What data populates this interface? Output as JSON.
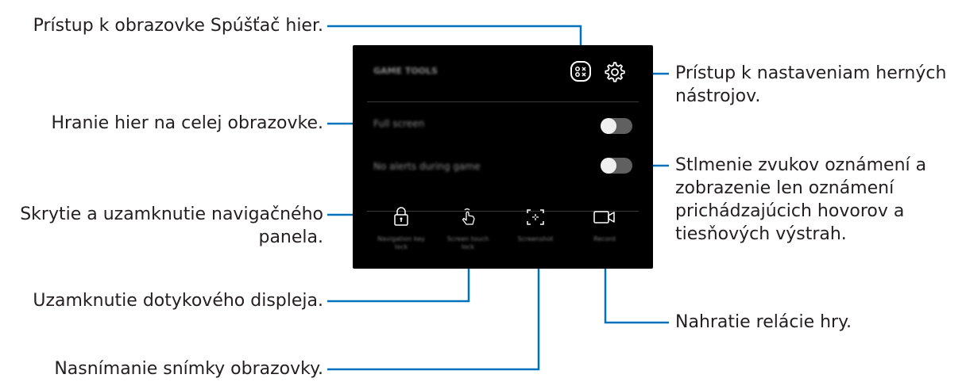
{
  "panel": {
    "title": "GAME TOOLS",
    "full_screen_label": "Full screen",
    "no_alerts_label": "No alerts during game",
    "full_screen_on": false,
    "no_alerts_on": false,
    "buttons": [
      {
        "label": "Navigation key lock",
        "icon": "lock-icon"
      },
      {
        "label": "Screen touch lock",
        "icon": "touch-hand-icon"
      },
      {
        "label": "Screenshot",
        "icon": "screenshot-icon"
      },
      {
        "label": "Record",
        "icon": "video-camera-icon"
      }
    ],
    "header_icons": [
      "game-launcher-icon",
      "gear-icon"
    ]
  },
  "callouts": {
    "game_launcher": "Prístup k obrazovke Spúšťač hier.",
    "settings_line1": "Prístup k nastaveniam herných",
    "settings_line2": "nástrojov.",
    "full_screen": "Hranie hier na celej obrazovke.",
    "alerts_line1": "Stlmenie zvukov oznámení a",
    "alerts_line2": "zobrazenie len oznámení",
    "alerts_line3": "prichádzajúcich hovorov a",
    "alerts_line4": "tiesňových výstrah.",
    "nav_lock_line1": "Skrytie a uzamknutie navigačného",
    "nav_lock_line2": "panela.",
    "touch_lock": "Uzamknutie dotykového displeja.",
    "record": "Nahratie relácie hry.",
    "screenshot": "Nasnímanie snímky obrazovky."
  },
  "colors": {
    "leader_line": "#0072bc",
    "panel_bg": "#000000",
    "text": "#231f20"
  }
}
